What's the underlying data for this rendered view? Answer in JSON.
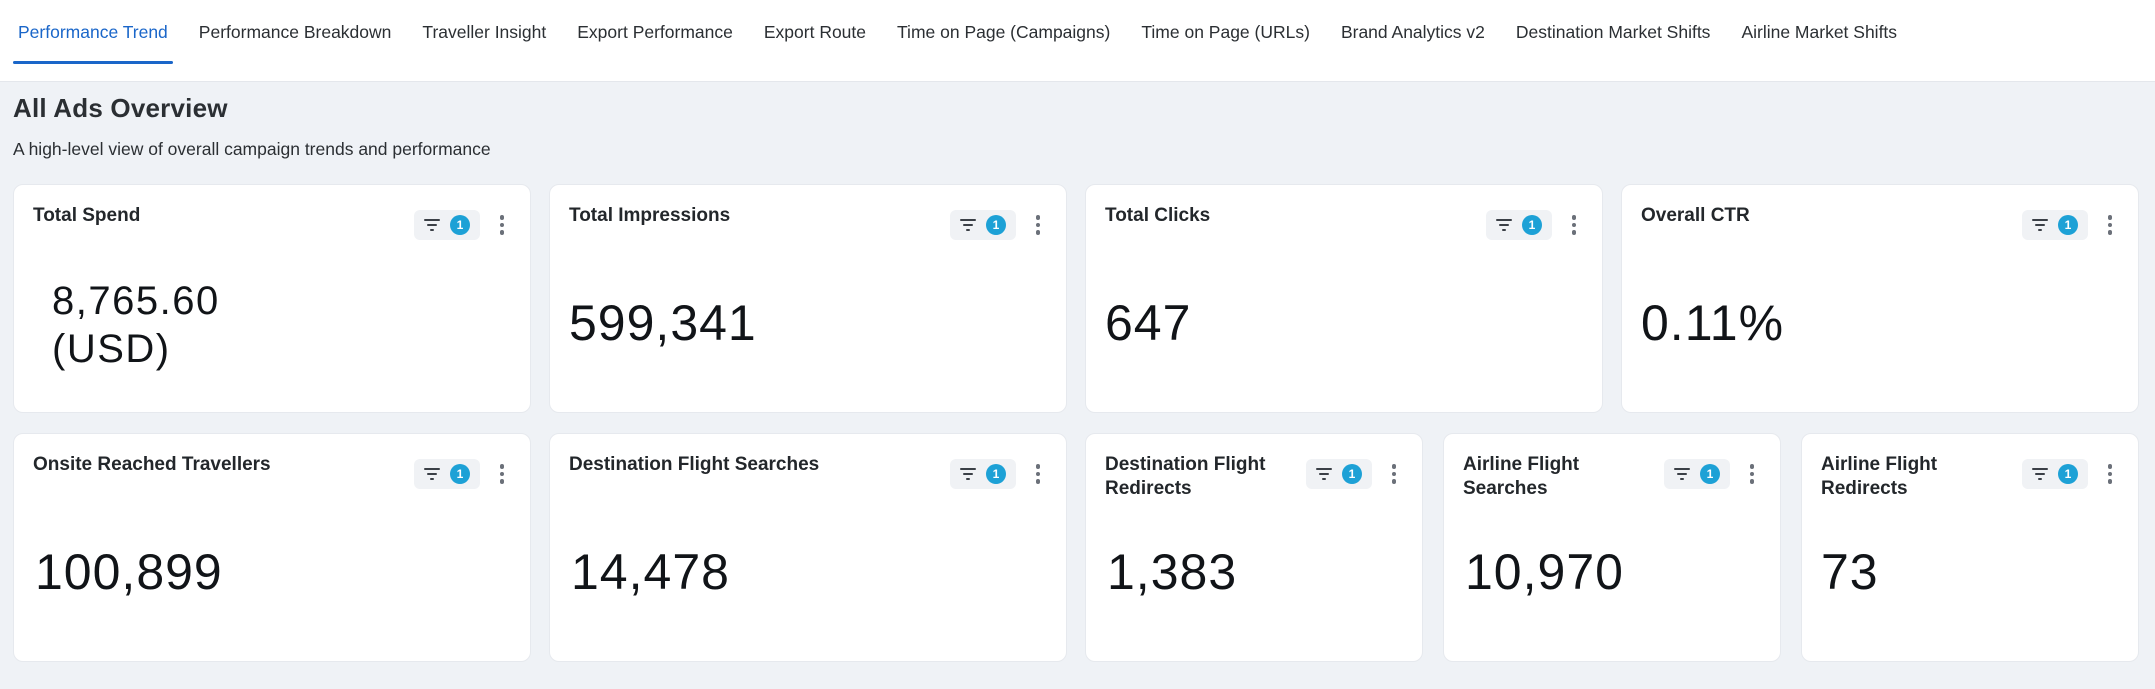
{
  "tabs": [
    {
      "label": "Performance Trend",
      "active": true
    },
    {
      "label": "Performance Breakdown",
      "active": false
    },
    {
      "label": "Traveller Insight",
      "active": false
    },
    {
      "label": "Export Performance",
      "active": false
    },
    {
      "label": "Export Route",
      "active": false
    },
    {
      "label": "Time on Page (Campaigns)",
      "active": false
    },
    {
      "label": "Time on Page (URLs)",
      "active": false
    },
    {
      "label": "Brand Analytics v2",
      "active": false
    },
    {
      "label": "Destination Market Shifts",
      "active": false
    },
    {
      "label": "Airline Market Shifts",
      "active": false
    }
  ],
  "header": {
    "title": "All Ads Overview",
    "subtitle": "A high-level view of overall campaign trends and performance"
  },
  "cards": [
    {
      "title": "Total Spend",
      "value_line1": "8,765.60",
      "value_line2": "(USD)",
      "filter_count": "1"
    },
    {
      "title": "Total Impressions",
      "value": "599,341",
      "filter_count": "1"
    },
    {
      "title": "Total Clicks",
      "value": "647",
      "filter_count": "1"
    },
    {
      "title": "Overall CTR",
      "value": "0.11%",
      "filter_count": "1"
    },
    {
      "title": "Onsite Reached Travellers",
      "value": "100,899",
      "filter_count": "1"
    },
    {
      "title": "Destination Flight Searches",
      "value": "14,478",
      "filter_count": "1"
    },
    {
      "title": "Destination Flight Redirects",
      "value": "1,383",
      "filter_count": "1"
    },
    {
      "title": "Airline Flight Searches",
      "value": "10,970",
      "filter_count": "1"
    },
    {
      "title": "Airline Flight Redirects",
      "value": "73",
      "filter_count": "1"
    }
  ],
  "icons": {
    "filter": "filter-icon",
    "menu": "kebab-menu-icon"
  },
  "colors": {
    "accent": "#1a66c9",
    "badge": "#1da1d6",
    "background": "#eff2f6"
  }
}
